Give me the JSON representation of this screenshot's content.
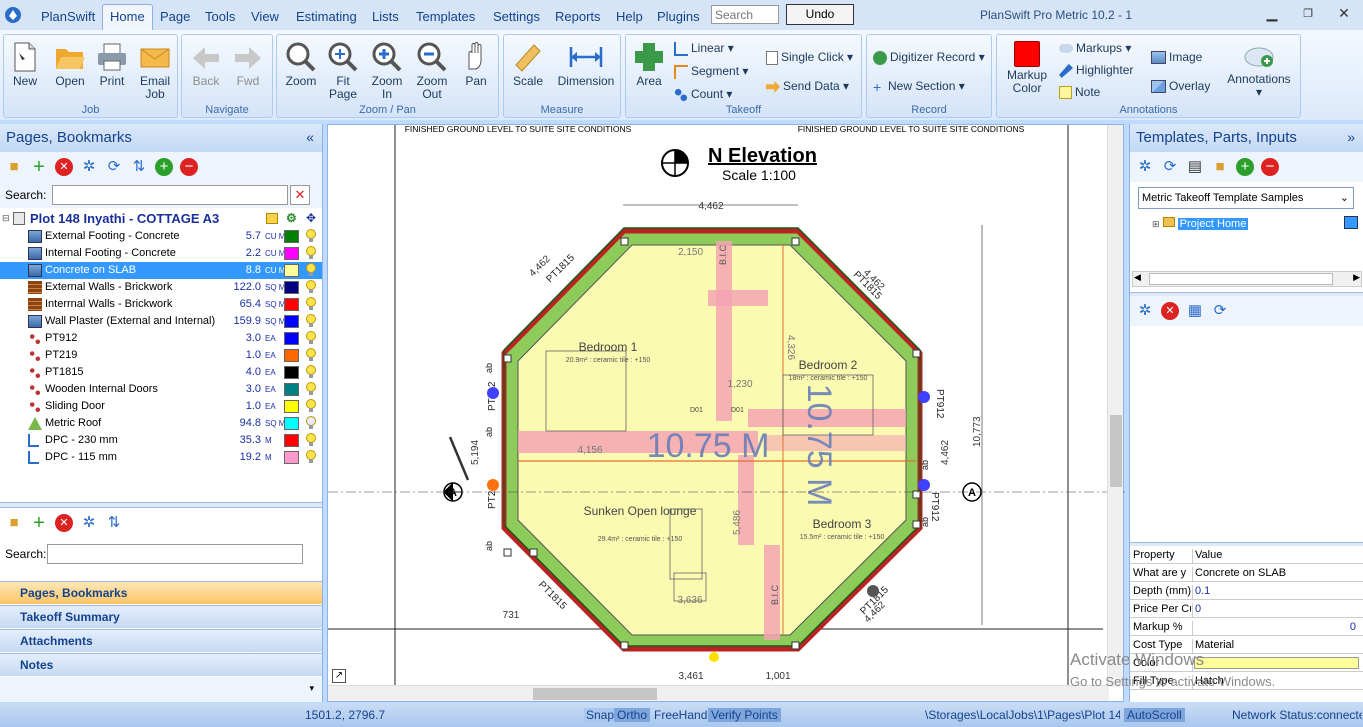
{
  "app": {
    "brand": "PlanSwift",
    "window_title": "PlanSwift Pro Metric 10.2 - 1",
    "search_placeholder": "Search",
    "undo_label": "Undo"
  },
  "menu_tabs": [
    "Home",
    "Page",
    "Tools",
    "View",
    "Estimating",
    "Lists",
    "Templates",
    "Settings",
    "Reports",
    "Help",
    "Plugins"
  ],
  "ribbon": {
    "job": {
      "label": "Job",
      "new": "New",
      "open": "Open",
      "print": "Print",
      "email": "Email Job"
    },
    "navigate": {
      "label": "Navigate",
      "back": "Back",
      "fwd": "Fwd"
    },
    "zoom": {
      "label": "Zoom / Pan",
      "zoom": "Zoom",
      "fit": "Fit Page",
      "zin": "Zoom In",
      "zout": "Zoom Out",
      "pan": "Pan"
    },
    "measure": {
      "label": "Measure",
      "scale": "Scale",
      "dimension": "Dimension"
    },
    "takeoff": {
      "label": "Takeoff",
      "area": "Area",
      "linear": "Linear",
      "segment": "Segment",
      "count": "Count",
      "single_click": "Single Click",
      "send_data": "Send Data"
    },
    "record": {
      "label": "Record",
      "digitizer": "Digitizer Record",
      "new_section": "New Section"
    },
    "annotations": {
      "label": "Annotations",
      "markup_color": "Markup Color",
      "markups": "Markups",
      "highlighter": "Highlighter",
      "note": "Note",
      "image": "Image",
      "overlay": "Overlay",
      "annotations": "Annotations"
    }
  },
  "left_panel": {
    "title": "Pages, Bookmarks",
    "search_label": "Search:",
    "root": "Plot 148 Inyathi - COTTAGE A3",
    "items": [
      {
        "name": "External Footing - Concrete",
        "value": "5.7",
        "unit": "CU M",
        "color": "#008000"
      },
      {
        "name": "Internal Footing - Concrete",
        "value": "2.2",
        "unit": "CU M",
        "color": "#ff00ff"
      },
      {
        "name": "Concrete on SLAB",
        "value": "8.8",
        "unit": "CU M",
        "color": "#ffff99"
      },
      {
        "name": "External Walls - Brickwork",
        "value": "122.0",
        "unit": "SQ M",
        "color": "#000080"
      },
      {
        "name": "Interrnal Walls - Brickwork",
        "value": "65.4",
        "unit": "SQ M",
        "color": "#ff0000"
      },
      {
        "name": "Wall Plaster (External and Internal)",
        "value": "159.9",
        "unit": "SQ M",
        "color": "#0000ff"
      },
      {
        "name": "PT912",
        "value": "3.0",
        "unit": "EA",
        "color": "#0000ff"
      },
      {
        "name": "PT219",
        "value": "1.0",
        "unit": "EA",
        "color": "#ff6600"
      },
      {
        "name": "PT1815",
        "value": "4.0",
        "unit": "EA",
        "color": "#000000"
      },
      {
        "name": "Wooden Internal Doors",
        "value": "3.0",
        "unit": "EA",
        "color": "#008080"
      },
      {
        "name": "Sliding Door",
        "value": "1.0",
        "unit": "EA",
        "color": "#ffff00"
      },
      {
        "name": "Metric Roof",
        "value": "94.8",
        "unit": "SQ M",
        "color": "#00ffff"
      },
      {
        "name": "DPC - 230 mm",
        "value": "35.3",
        "unit": "M",
        "color": "#ff0000"
      },
      {
        "name": "DPC - 115 mm",
        "value": "19.2",
        "unit": "M",
        "color": "#ff99cc"
      }
    ],
    "second_search_label": "Search:",
    "nav": [
      "Pages, Bookmarks",
      "Takeoff Summary",
      "Attachments",
      "Notes"
    ]
  },
  "drawing": {
    "title": "N Elevation",
    "scale": "Scale 1:100",
    "note_left": "FINISHED GROUND LEVEL TO SUITE SITE CONDITIONS",
    "note_right": "FINISHED GROUND LEVEL TO SUITE SITE CONDITIONS",
    "dim_top": "4,462",
    "dim_right": "10,773",
    "dim_right2": "4,462",
    "dim_bottom": "3,461",
    "dim_bottom2": "1,001",
    "dim_left": "5,194",
    "dim_731": "731",
    "dim_4462a": "4,462",
    "dim_4462b": "4,462",
    "dim_4462c": "4,462",
    "room1": "Bedroom 1",
    "room1_sub": "20.9m² : ceramic tile : +150",
    "room2": "Bedroom 2",
    "room2_sub": "18m² : ceramic tile : +150",
    "room3": "Bedroom 3",
    "room3_sub": "15.5m² : ceramic tile : +150",
    "lounge": "Sunken Open lounge",
    "lounge_sub": "29.4m² : ceramic tile : +150",
    "measure_h": "10.75 M",
    "measure_v": "10.75 M",
    "bic": "B.I.C",
    "d01": "D01",
    "pt1815": "PT1815",
    "pt912": "PT912",
    "pt219": "PT219",
    "ab": "ab",
    "d1230": "1,230",
    "d4156": "4,156",
    "d3636": "3,636",
    "d5486": "5,486",
    "d2150": "2,150",
    "d4326": "4,326",
    "section_marker": "A"
  },
  "right_panel": {
    "title": "Templates, Parts, Inputs",
    "template_select": "Metric Takeoff Template Samples",
    "tree_root": "Project Home",
    "props": [
      {
        "k": "Property",
        "v": "Value"
      },
      {
        "k": "What are y",
        "v": "Concrete on SLAB"
      },
      {
        "k": "Depth (mm)",
        "v": "0.1"
      },
      {
        "k": "Price Per Cu",
        "v": "0"
      },
      {
        "k": "Markup %",
        "v": "0"
      },
      {
        "k": "Cost Type",
        "v": "Material"
      },
      {
        "k": "Color",
        "v": ""
      },
      {
        "k": "Fill Type",
        "v": "Hatch"
      }
    ],
    "color_value": "#ffff99"
  },
  "watermark": {
    "line1": "Activate Windows",
    "line2": "Go to Settings to activate Windows."
  },
  "status": {
    "coords": "1501.2, 2796.7",
    "snap": "Snap",
    "ortho": "Ortho",
    "freehand": "FreeHand",
    "verify": "Verify Points",
    "path": "\\Storages\\LocalJobs\\1\\Pages\\Plot 148 I",
    "autoscroll": "AutoScroll",
    "network": "Network Status:connected"
  }
}
